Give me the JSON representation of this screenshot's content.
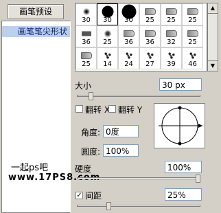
{
  "top_button": {
    "label": "画笔预设"
  },
  "sidebar": {
    "items": [
      {
        "label": "画笔笔尖形状"
      }
    ]
  },
  "watermark": {
    "line1": "一起ps吧",
    "line2": "www.17PS8.com"
  },
  "brush_presets": {
    "rows": [
      [
        {
          "size": "30",
          "kind": "soft"
        },
        {
          "size": "30",
          "kind": "hard",
          "selected": true
        },
        {
          "size": "30",
          "kind": "hard-big"
        },
        {
          "size": "25",
          "kind": "tool"
        },
        {
          "size": "25",
          "kind": "tool"
        },
        {
          "size": "25",
          "kind": "tool"
        }
      ],
      [
        {
          "size": "36",
          "kind": "pencil"
        },
        {
          "size": "25",
          "kind": "splatter"
        },
        {
          "size": "36",
          "kind": "tool"
        },
        {
          "size": "36",
          "kind": "tool"
        },
        {
          "size": "32",
          "kind": "tool"
        },
        {
          "size": "25",
          "kind": "tool"
        }
      ],
      [
        {
          "size": "25",
          "kind": "tool"
        },
        {
          "size": "14",
          "kind": "scatter"
        },
        {
          "size": "24",
          "kind": "scatter"
        },
        {
          "size": "27",
          "kind": "scatter"
        },
        {
          "size": "39",
          "kind": "scatter"
        },
        {
          "size": "46",
          "kind": "scatter"
        }
      ]
    ]
  },
  "size": {
    "label": "大小",
    "value": "30 px",
    "fraction": 0.1
  },
  "flip_x": {
    "label": "翻转 X",
    "checked": false
  },
  "flip_y": {
    "label": "翻转 Y",
    "checked": false
  },
  "angle": {
    "label": "角度:",
    "value": "0度"
  },
  "roundness": {
    "label": "圆度:",
    "value": "100%"
  },
  "hardness": {
    "label": "硬度",
    "value": "100%",
    "fraction": 1.0
  },
  "spacing": {
    "label": "间距",
    "value": "25%",
    "checked": true,
    "fraction": 0.25
  },
  "colors": {
    "selection": "#bcd0ec",
    "selection_text": "#0a246a",
    "panel_bg": "#d4d0c8"
  }
}
